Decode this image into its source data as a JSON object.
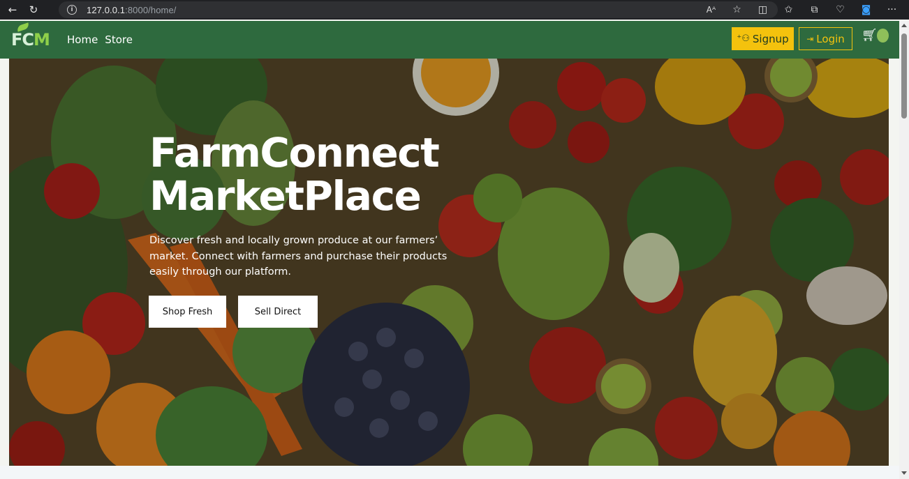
{
  "browser": {
    "url_host": "127.0.0.1",
    "url_rest": ":8000/home/",
    "icons": [
      "back-icon",
      "reload-icon",
      "info-icon",
      "read-aloud-icon",
      "favorite-star-icon",
      "split-screen-icon",
      "favorites-icon",
      "collections-icon",
      "health-icon",
      "edge-icon",
      "more-icon"
    ],
    "read_aloud": "Aᴬ",
    "more": "···"
  },
  "navbar": {
    "logo_fc": "FC",
    "logo_m": "M",
    "links": [
      "Home",
      "Store"
    ],
    "signup_label": "Signup",
    "login_label": "Login",
    "brand_color": "#2e6a3e",
    "accent_color": "#f4c20d"
  },
  "hero": {
    "title_line1": "FarmConnect",
    "title_line2": "MarketPlace",
    "description": "Discover fresh and locally grown produce at our farmers’ market. Connect with farmers and purchase their products easily through our platform.",
    "buttons": [
      "Shop Fresh",
      "Sell Direct"
    ]
  }
}
